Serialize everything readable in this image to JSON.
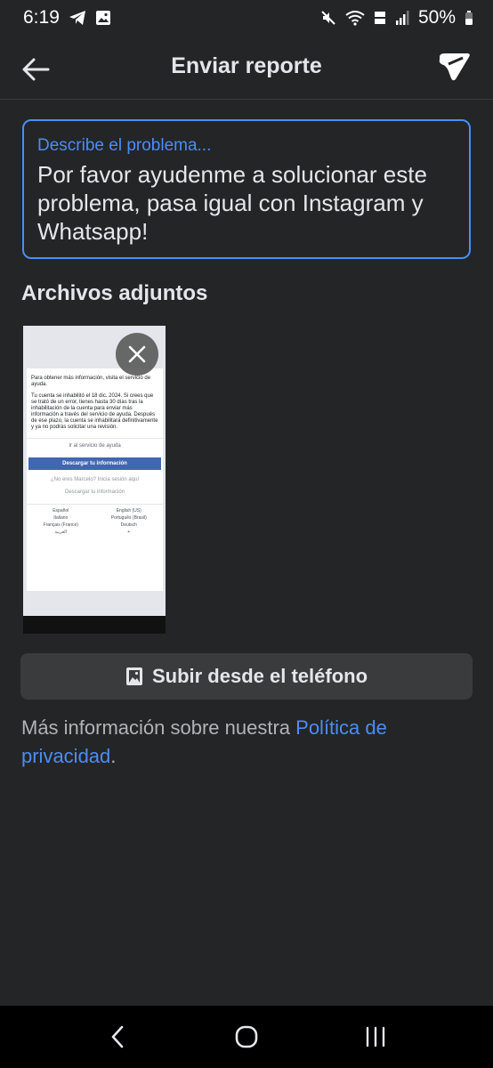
{
  "status_bar": {
    "time": "6:19",
    "battery": "50%"
  },
  "header": {
    "title": "Enviar reporte"
  },
  "description": {
    "placeholder": "Describe el problema...",
    "value": "Por favor ayudenme a solucionar este problema, pasa igual con Instagram y Whatsapp!"
  },
  "attachments": {
    "title": "Archivos adjuntos",
    "preview": {
      "line1": "Para obtener más información, visita el servicio de ayuda.",
      "line2": "Tu cuenta se inhabilitó el 18 dic. 2024. Si crees que se trató de un error, tienes hasta 30 días tras la inhabilitación de la cuenta para enviar más información a través del servicio de ayuda. Después de ese plazo, la cuenta se inhabilitará definitivamente y ya no podrás solicitar una revisión.",
      "help_link": "Ir al servicio de ayuda",
      "download_btn": "Descargar tu información",
      "not_you": "¿No eres Marcelo? Inicia sesión aquí",
      "download_link": "Descargar tu información",
      "langs": [
        "Español",
        "English (US)",
        "Italiano",
        "Português (Brasil)",
        "Français (France)",
        "Deutsch",
        "العربية",
        "+"
      ]
    }
  },
  "upload": {
    "label": "Subir desde el teléfono"
  },
  "privacy": {
    "text": "Más información sobre nuestra ",
    "link": "Política de privacidad",
    "end": "."
  },
  "colors": {
    "background": "#242526",
    "accent": "#4b8df8",
    "button_bg": "#3a3b3c"
  }
}
